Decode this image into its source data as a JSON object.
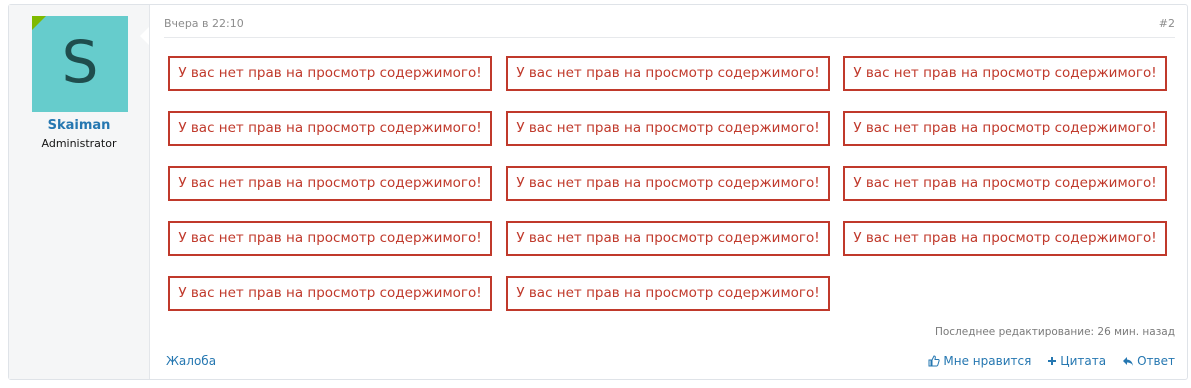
{
  "user": {
    "avatar_letter": "S",
    "username": "Skaiman",
    "title": "Administrator"
  },
  "post": {
    "date": "Вчера в 22:10",
    "number": "#2",
    "no_access_text": "У вас нет прав на просмотр содержимого!",
    "no_access_blocks": [
      "У вас нет прав на просмотр содержимого!",
      "У вас нет прав на просмотр содержимого!",
      "У вас нет прав на просмотр содержимого!",
      "У вас нет прав на просмотр содержимого!",
      "У вас нет прав на просмотр содержимого!",
      "У вас нет прав на просмотр содержимого!",
      "У вас нет прав на просмотр содержимого!",
      "У вас нет прав на просмотр содержимого!",
      "У вас нет прав на просмотр содержимого!",
      "У вас нет прав на просмотр содержимого!",
      "У вас нет прав на просмотр содержимого!",
      "У вас нет прав на просмотр содержимого!",
      "У вас нет прав на просмотр содержимого!",
      "У вас нет прав на просмотр содержимого!"
    ],
    "last_edited": "Последнее редактирование: 26 мин. назад"
  },
  "footer": {
    "report_label": "Жалоба",
    "like_label": "Мне нравится",
    "quote_label": "Цитата",
    "reply_label": "Ответ"
  },
  "colors": {
    "link": "#2577b1",
    "error": "#c0392b",
    "avatar_bg": "#66cccc",
    "online": "#7fb900"
  },
  "icons": {
    "like": "thumbs-up-icon",
    "quote": "plus-icon",
    "reply": "reply-arrow-icon"
  }
}
